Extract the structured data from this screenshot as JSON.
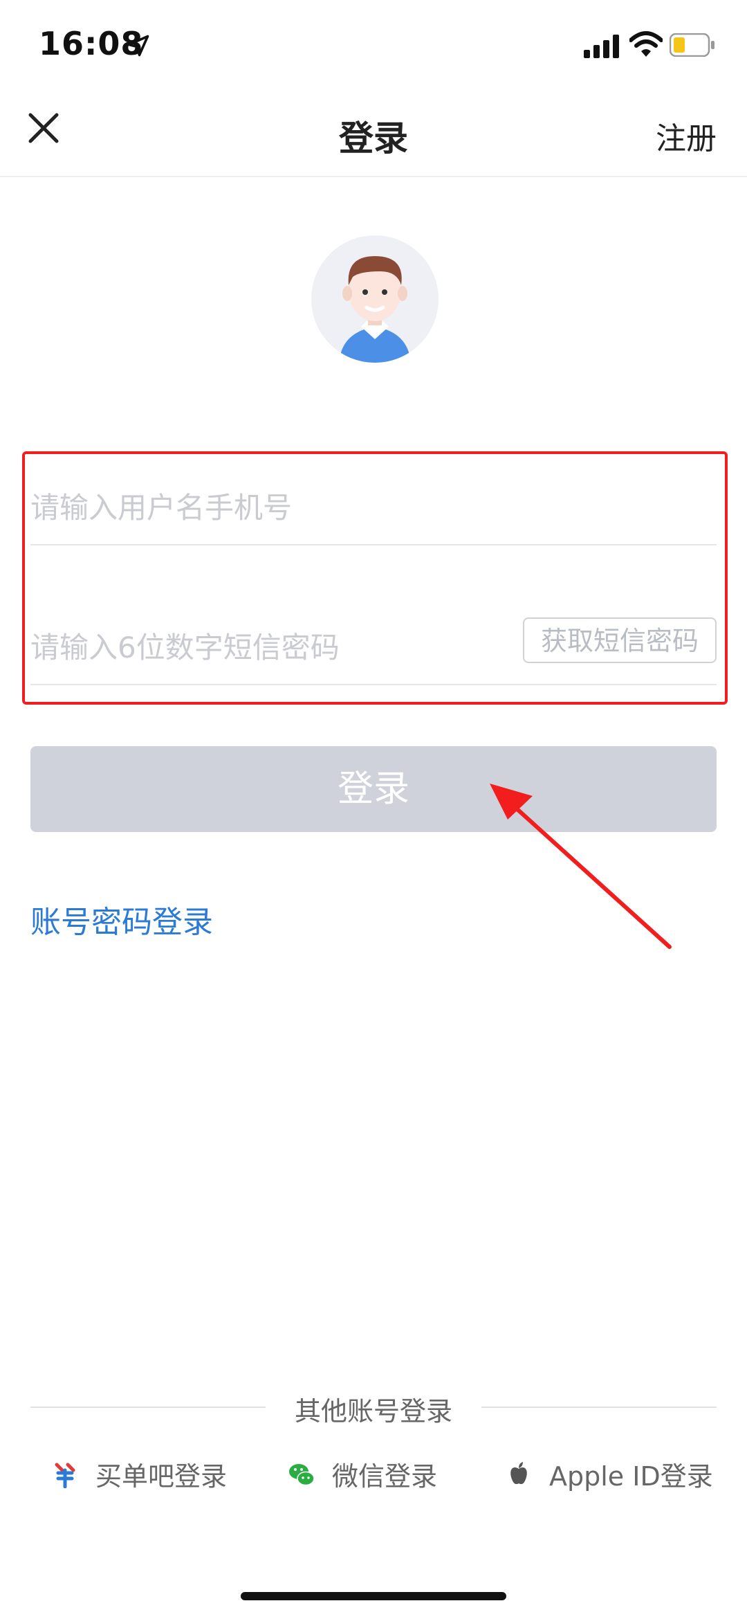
{
  "status_bar": {
    "time": "16:08"
  },
  "nav": {
    "title": "登录",
    "right_action": "注册"
  },
  "form": {
    "username_placeholder": "请输入用户名手机号",
    "sms_placeholder": "请输入6位数字短信密码",
    "get_sms_label": "获取短信密码"
  },
  "login_button": "登录",
  "password_login_link": "账号密码登录",
  "other_login": {
    "title": "其他账号登录",
    "options": [
      {
        "label": "买单吧登录",
        "icon": "maidanba-logo-icon"
      },
      {
        "label": "微信登录",
        "icon": "wechat-icon"
      },
      {
        "label": "Apple ID登录",
        "icon": "apple-icon"
      }
    ]
  },
  "colors": {
    "link": "#2b7bd6",
    "highlight": "#f21d1d",
    "button_disabled": "#cfd2da"
  }
}
